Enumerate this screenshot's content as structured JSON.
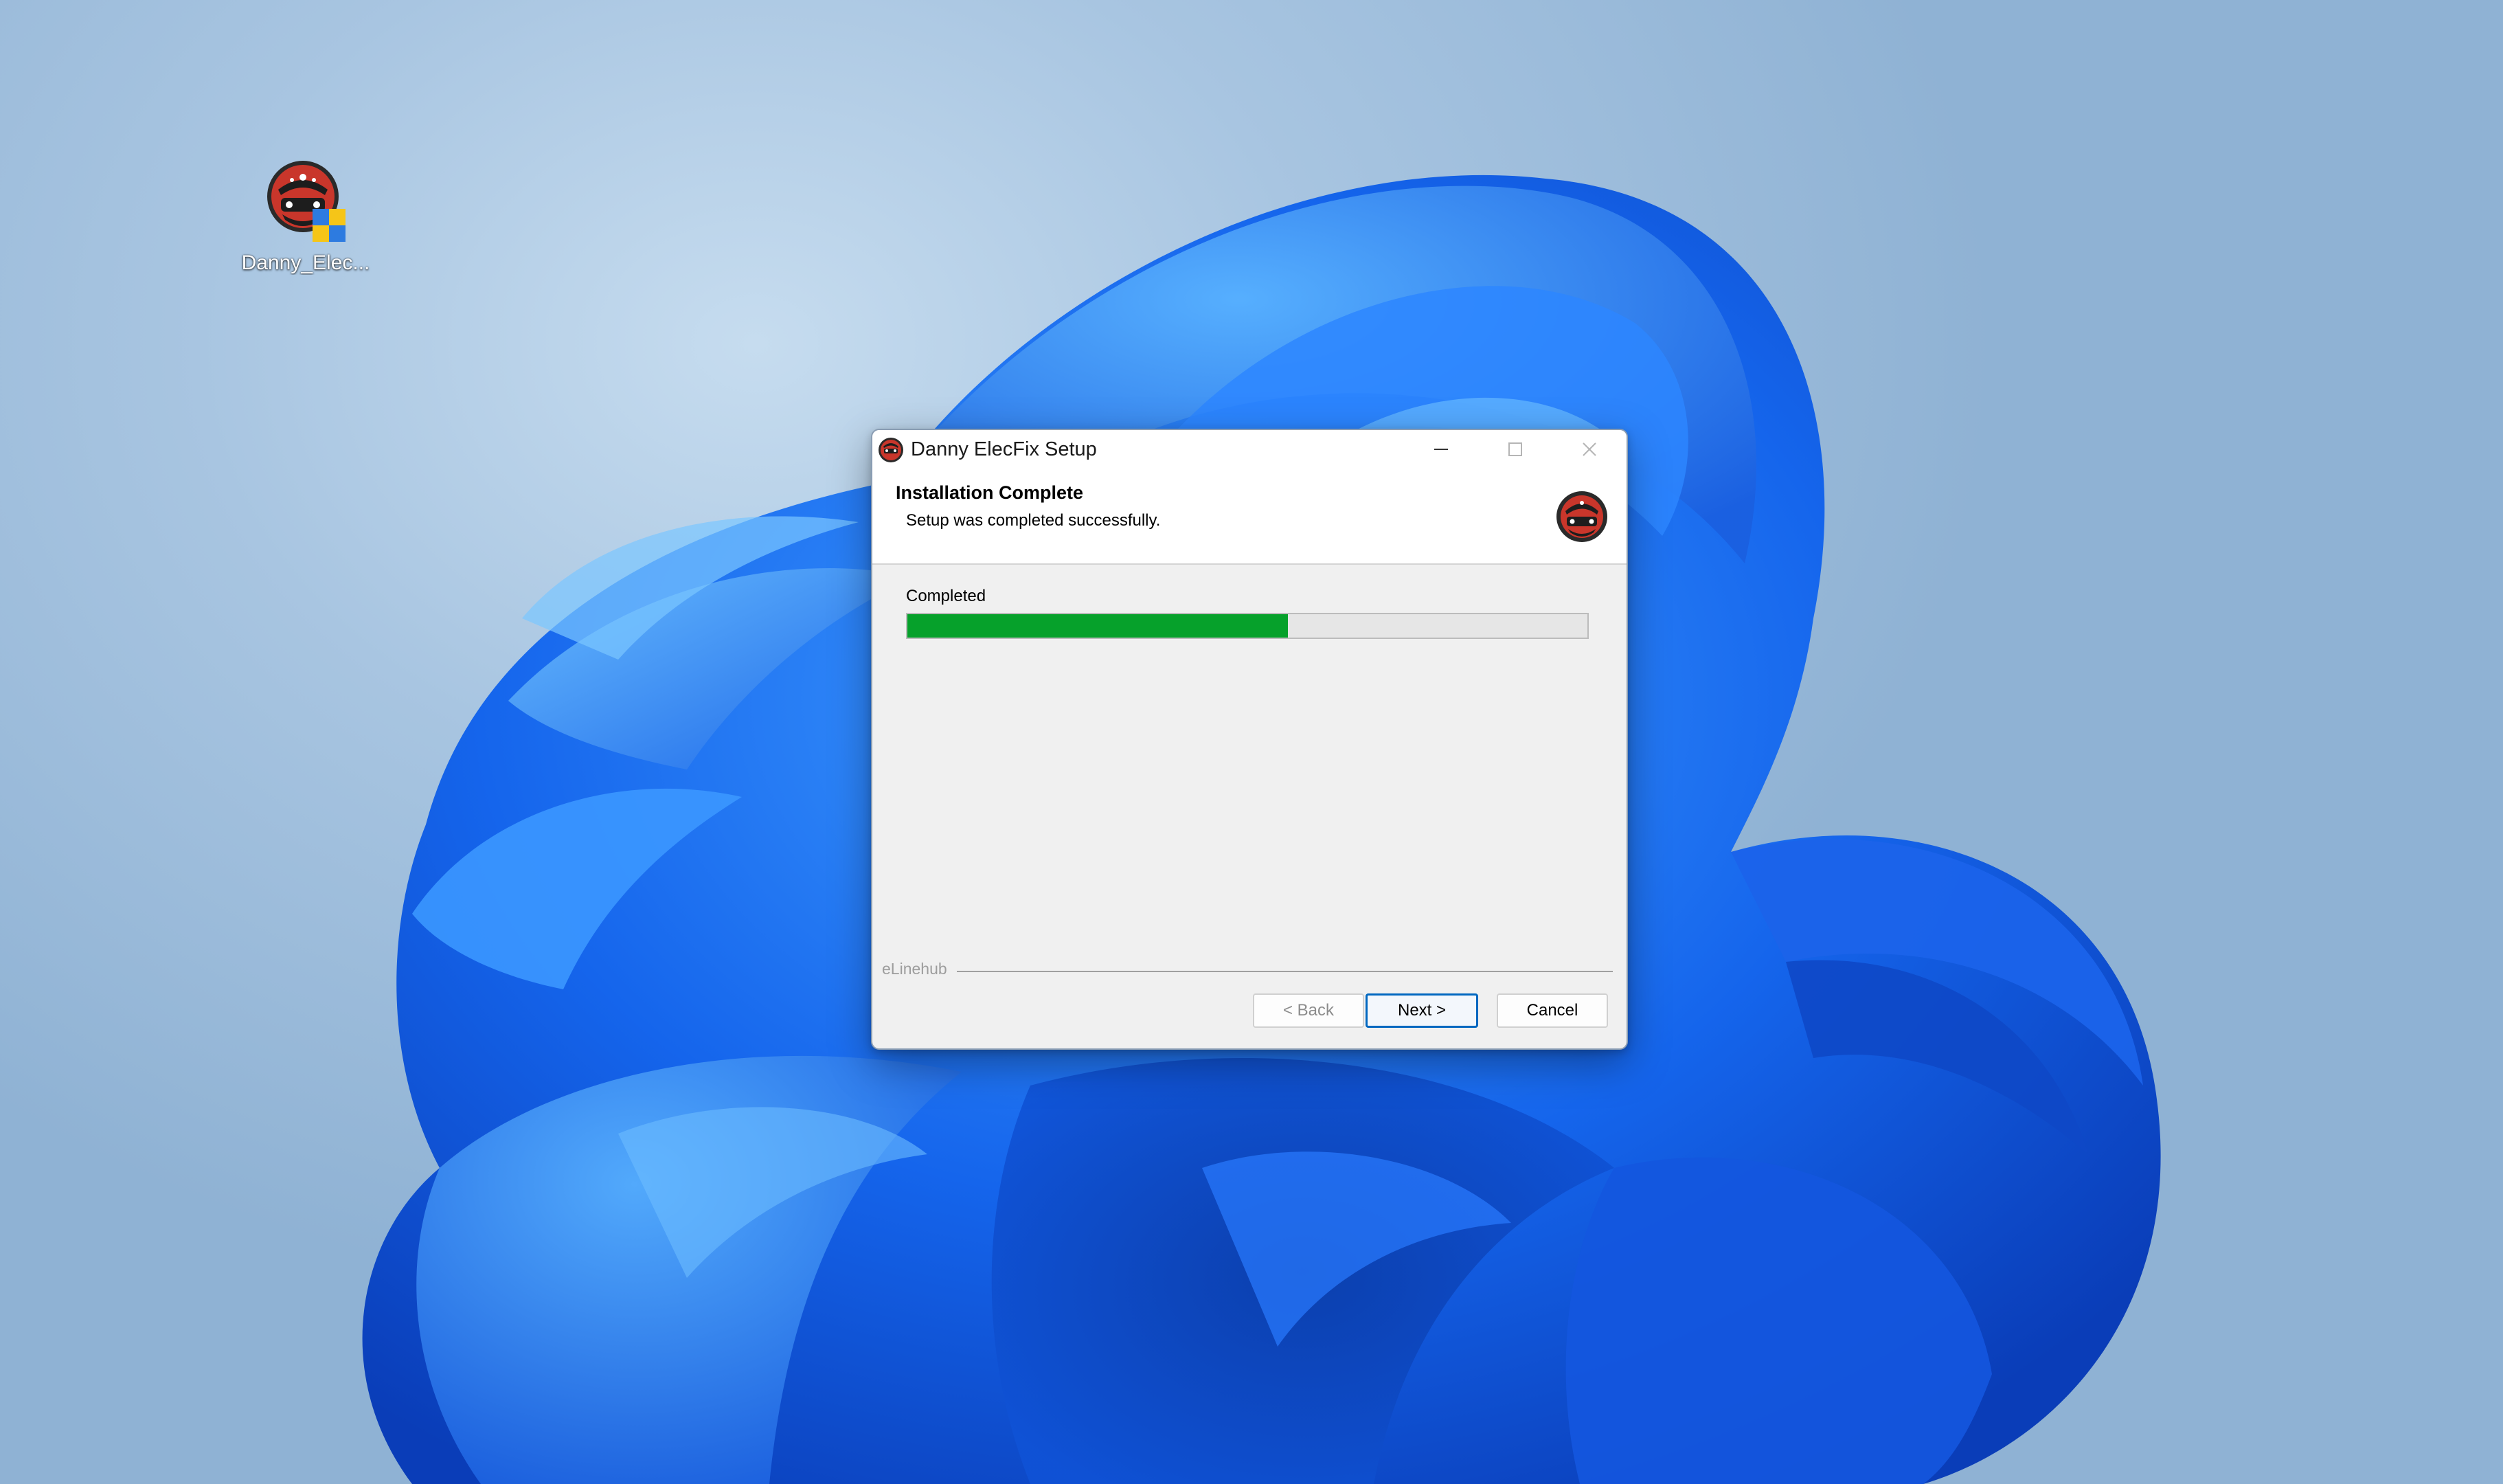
{
  "desktop": {
    "icons": [
      {
        "label": "Danny_Elec...",
        "icon": "danny-elecfix-logo-icon"
      }
    ]
  },
  "window": {
    "title": "Danny ElecFix Setup",
    "app_icon": "danny-elecfix-logo-icon",
    "controls": [
      "minimize-icon",
      "maximize-icon",
      "close-icon"
    ]
  },
  "header": {
    "title": "Installation Complete",
    "subtitle": "Setup was completed successfully.",
    "logo_icon": "danny-elecfix-logo-icon"
  },
  "progress": {
    "label": "Completed",
    "value_percent": 56,
    "fill_color": "#06a12b"
  },
  "footer": {
    "brand": "eLinehub"
  },
  "buttons": {
    "back_label": "< Back",
    "next_label": "Next >",
    "cancel_label": "Cancel"
  },
  "colors": {
    "accent": "#0067c0",
    "progress_green": "#06a12b"
  }
}
